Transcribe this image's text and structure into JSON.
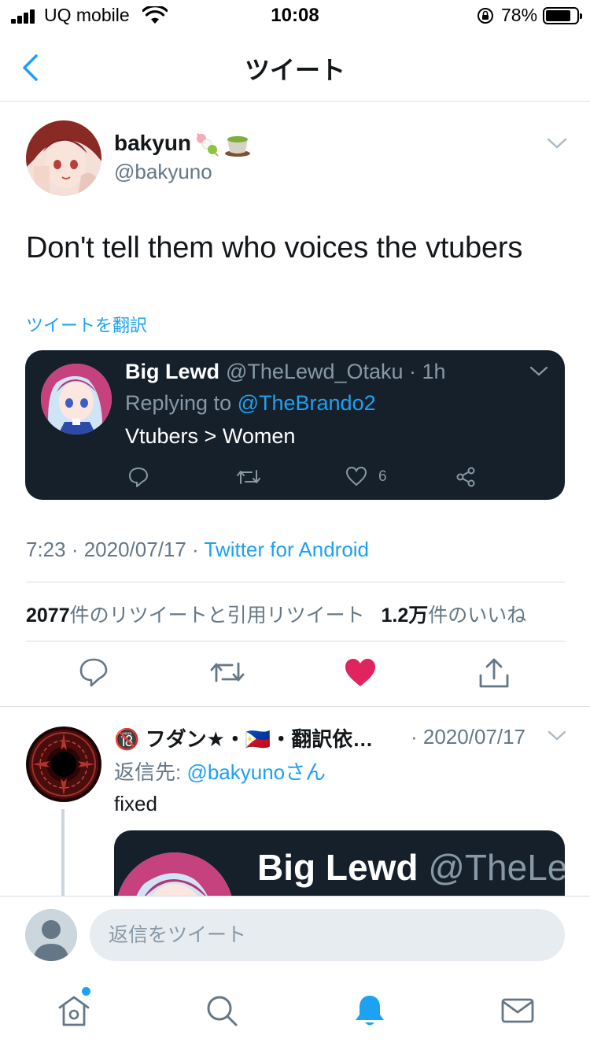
{
  "status_bar": {
    "carrier": "UQ mobile",
    "time": "10:08",
    "battery_percent": "78%",
    "battery_level": 0.78
  },
  "nav": {
    "title": "ツイート"
  },
  "tweet": {
    "author_name": "bakyun",
    "author_handle": "@bakyuno",
    "emojis": [
      "dango-emoji",
      "green-tea-emoji"
    ],
    "text": "Don't tell them who voices the vtubers",
    "translate_label": "ツイートを翻訳",
    "timestamp": "7:23 · 2020/07/17 · ",
    "source": "Twitter for Android",
    "retweet_count": "2077",
    "retweet_label": "件のリツイートと引用リツイート",
    "like_count": "1.2万",
    "like_label": "件のいいね"
  },
  "quoted_image": {
    "name": "Big Lewd",
    "handle": "@TheLewd_Otaku · 1h",
    "replying_prefix": "Replying to ",
    "replying_link": "@TheBrando2",
    "text": "Vtubers > Women",
    "like_count": "6"
  },
  "reply": {
    "name": "🔞 フダン★・🇵🇭・翻訳依…",
    "date": "· 2020/07/17",
    "reply_to_prefix": "返信先: ",
    "reply_to_handle": "@bakyunoさん",
    "text": "fixed",
    "image_name": "Big Lewd",
    "image_handle": " @TheLe"
  },
  "composer": {
    "placeholder": "返信をツイート"
  },
  "tabs": [
    "home-tab",
    "search-tab",
    "notifications-tab",
    "messages-tab"
  ],
  "colors": {
    "accent": "#1da1f2",
    "like": "#e0245e",
    "dark_card": "#15202b"
  }
}
